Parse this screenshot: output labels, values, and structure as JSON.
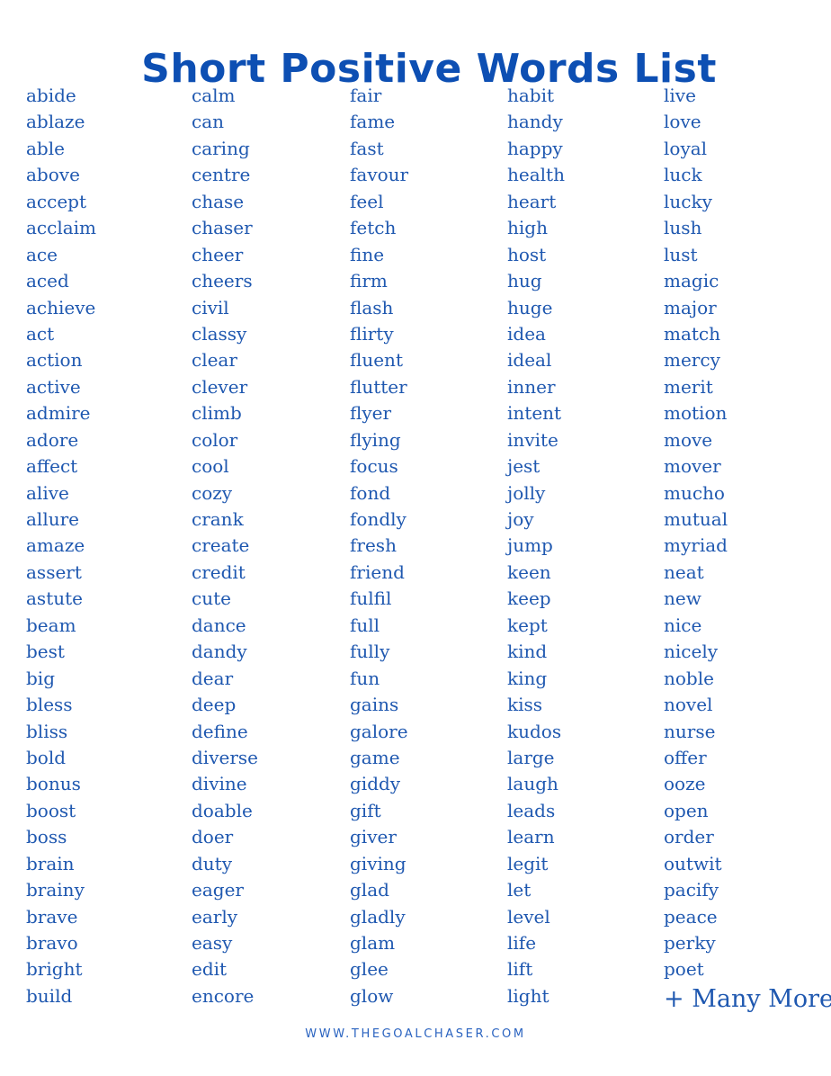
{
  "title": "Short Positive Words List",
  "columns": [
    [
      "abide",
      "ablaze",
      "able",
      "above",
      "accept",
      "acclaim",
      "ace",
      "aced",
      "achieve",
      "act",
      "action",
      "active",
      "admire",
      "adore",
      "affect",
      "alive",
      "allure",
      "amaze",
      "assert",
      "astute",
      "beam",
      "best",
      "big",
      "bless",
      "bliss",
      "bold",
      "bonus",
      "boost",
      "boss",
      "brain",
      "brainy",
      "brave",
      "bravo",
      "bright",
      "build"
    ],
    [
      "calm",
      "can",
      "caring",
      "centre",
      "chase",
      "chaser",
      "cheer",
      "cheers",
      "civil",
      "classy",
      "clear",
      "clever",
      "climb",
      "color",
      "cool",
      "cozy",
      "crank",
      "create",
      "credit",
      "cute",
      "dance",
      "dandy",
      "dear",
      "deep",
      "define",
      "diverse",
      "divine",
      "doable",
      "doer",
      "duty",
      "eager",
      "early",
      "easy",
      "edit",
      "encore"
    ],
    [
      "fair",
      "fame",
      "fast",
      "favour",
      "feel",
      "fetch",
      "fine",
      "firm",
      "flash",
      "flirty",
      "fluent",
      "flutter",
      "flyer",
      "flying",
      "focus",
      "fond",
      "fondly",
      "fresh",
      "friend",
      "fulfil",
      "full",
      "fully",
      "fun",
      "gains",
      "galore",
      "game",
      "giddy",
      "gift",
      "giver",
      "giving",
      "glad",
      "gladly",
      "glam",
      "glee",
      "glow"
    ],
    [
      "habit",
      "handy",
      "happy",
      "health",
      "heart",
      "high",
      "host",
      "hug",
      "huge",
      "idea",
      "ideal",
      "inner",
      "intent",
      "invite",
      "jest",
      "jolly",
      "joy",
      "jump",
      "keen",
      "keep",
      "kept",
      "kind",
      "king",
      "kiss",
      "kudos",
      "large",
      "laugh",
      "leads",
      "learn",
      "legit",
      "let",
      "level",
      "life",
      "lift",
      "light"
    ],
    [
      "live",
      "love",
      "loyal",
      "luck",
      "lucky",
      "lush",
      "lust",
      "magic",
      "major",
      "match",
      "mercy",
      "merit",
      "motion",
      "move",
      "mover",
      "mucho",
      "mutual",
      "myriad",
      "neat",
      "new",
      "nice",
      "nicely",
      "noble",
      "novel",
      "nurse",
      "offer",
      "ooze",
      "open",
      "order",
      "outwit",
      "pacify",
      "peace",
      "perky",
      "poet"
    ]
  ],
  "more_label": "+ Many More!",
  "footer": "WWW.THEGOALCHASER.COM",
  "colors": {
    "title": "#0d4fb3",
    "words": "#1f58b0",
    "footer": "#2a63c0",
    "background": "#ffffff"
  }
}
